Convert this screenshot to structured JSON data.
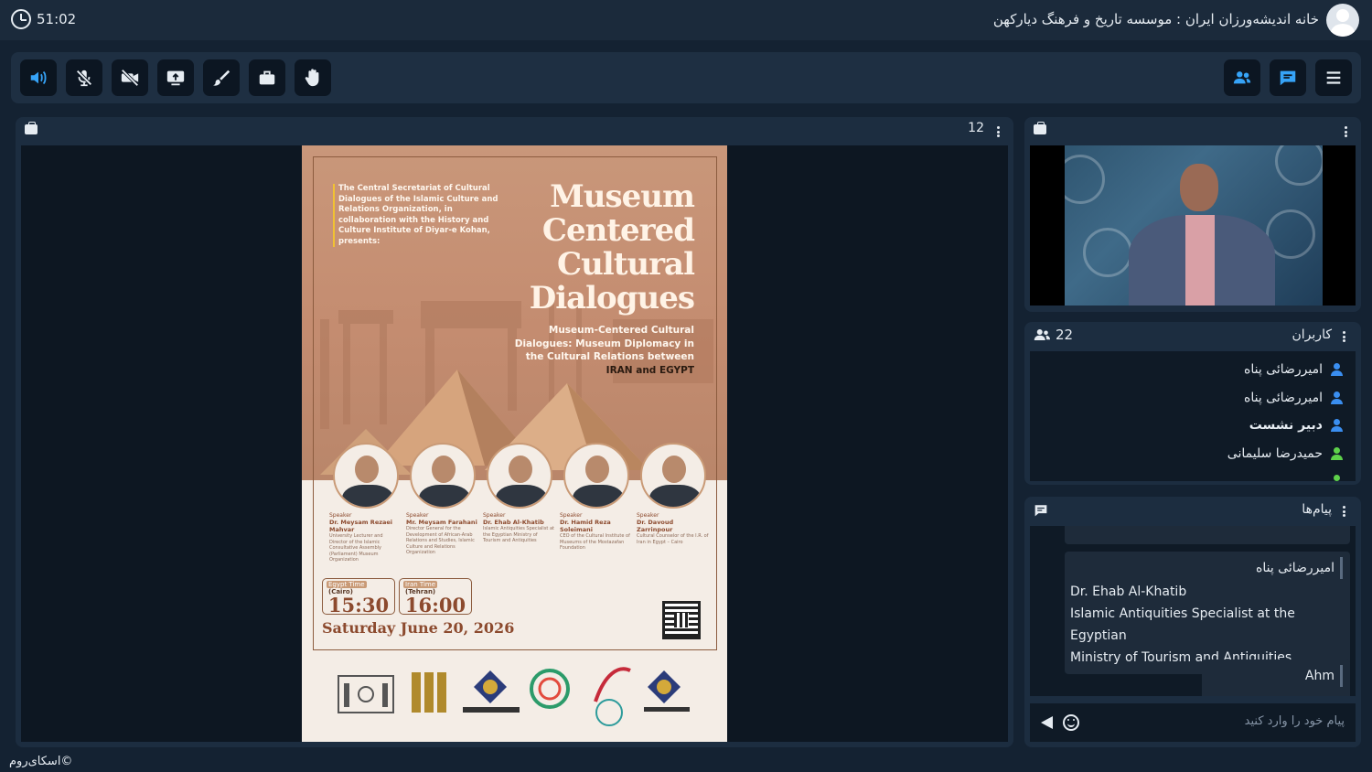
{
  "topbar": {
    "timer": "51:02",
    "room_title": "خانه اندیشه‌ورزان ایران : موسسه تاریخ و فرهنگ دیارکهن"
  },
  "toolbar": {
    "left_icons": [
      "speaker-icon",
      "mic-off-icon",
      "camera-off-icon",
      "screen-share-icon",
      "brush-icon",
      "briefcase-icon",
      "raise-hand-icon"
    ],
    "right_icons": [
      "users-icon",
      "chat-icon",
      "menu-icon"
    ],
    "accent": "#36a3f7"
  },
  "stage": {
    "page_number": "12",
    "poster": {
      "intro": "The Central Secretariat of Cultural Dialogues of the Islamic Culture and Relations Organization, in collaboration with the History and Culture Institute of Diyar-e Kohan, presents:",
      "title_lines": [
        "Museum",
        "Centered",
        "Cultural",
        "Dialogues"
      ],
      "subtitle": "Museum-Centered Cultural Dialogues: Museum Diplomacy in the Cultural Relations between",
      "subtitle_end": "IRAN and EGYPT",
      "speakers": [
        {
          "tag": "Speaker",
          "name": "Dr. Meysam Rezaei Mahvar",
          "role": "University Lecturer and Director of the Islamic Consultative Assembly (Parliament) Museum Organization"
        },
        {
          "tag": "Speaker",
          "name": "Mr. Meysam Farahani",
          "role": "Director General for the Development of African-Arab Relations and Studies, Islamic Culture and Relations Organization"
        },
        {
          "tag": "Speaker",
          "name": "Dr. Ehab Al-Khatib",
          "role": "Islamic Antiquities Specialist at the Egyptian Ministry of Tourism and Antiquities"
        },
        {
          "tag": "Speaker",
          "name": "Dr. Hamid Reza Soleimani",
          "role": "CEO of the Cultural Institute of Museums of the Mostazafan Foundation"
        },
        {
          "tag": "Speaker",
          "name": "Dr. Davoud Zarrinpour",
          "role": "Cultural Counselor of the I.R. of Iran in Egypt – Cairo"
        }
      ],
      "egypt_time_label": "Egypt Time",
      "egypt_city": "(Cairo)",
      "egypt_time": "15:30",
      "iran_time_label": "Iran Time",
      "iran_city": "(Tehran)",
      "iran_time": "16:00",
      "date": "Saturday June 20, 2026"
    }
  },
  "users": {
    "title": "کاربران",
    "count": "22",
    "list": [
      {
        "name": "امیررضائی پناه",
        "color": "#3a8ef0",
        "bold": false
      },
      {
        "name": "امیررضائی پناه",
        "color": "#3a8ef0",
        "bold": false
      },
      {
        "name": "دبیر نشست",
        "color": "#3a8ef0",
        "bold": true
      },
      {
        "name": "حمیدرضا سلیمانی",
        "color": "#5ed14a",
        "bold": false
      }
    ]
  },
  "messages": {
    "title": "پیام‌ها",
    "items": [
      {
        "sender": "امیررضائی پناه",
        "lines": [
          "Dr. Ehab Al-Khatib",
          "Islamic Antiquities Specialist at the Egyptian",
          "Ministry of Tourism and Antiquities"
        ]
      },
      {
        "sender": "Ahm",
        "lines": []
      }
    ],
    "input_placeholder": "پیام خود را وارد کنید"
  },
  "footer": {
    "brand": "©اسکای‌روم"
  }
}
